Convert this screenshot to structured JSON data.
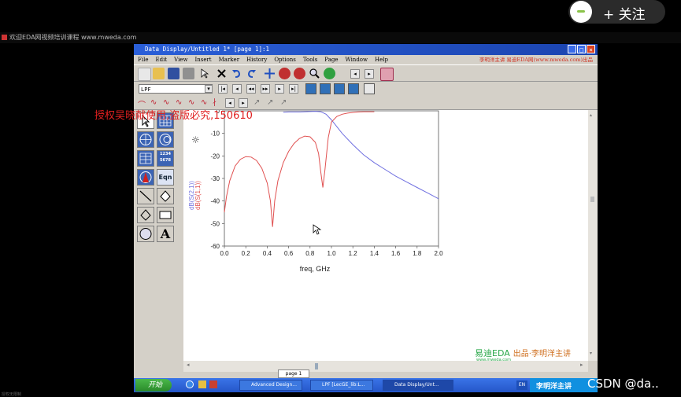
{
  "overlay": {
    "follow_label": "+ 关注"
  },
  "desktop": {
    "title": "欢迎EDA网视频培训课程 www.mweda.com",
    "bottom_text": "授权无限制"
  },
  "window": {
    "title": "Data Display/Untitled 1* [page 1]:1",
    "menu": [
      "File",
      "Edit",
      "View",
      "Insert",
      "Marker",
      "History",
      "Options",
      "Tools",
      "Page",
      "Window",
      "Help"
    ],
    "menu_ad": "李明洋主讲  易迪EDA网(www.mweda.com)出品",
    "page_select": "LPF",
    "page_tab": "page 1",
    "controls": {
      "minimize": "_",
      "maximize": "□",
      "close": "×"
    }
  },
  "watermark": "授权吴晓献使用,盗版必究,150610",
  "logo": {
    "brand": "易迪EDA",
    "sub": "出品·李明洋主讲",
    "url": "www.mweda.com"
  },
  "palette": {
    "eqn_label": "Eqn",
    "table_label": "1234 5678",
    "text_label": "A"
  },
  "taskbar": {
    "start": "开始",
    "tasks": [
      "Advanced Design...",
      "LPF [LecGE_lib:L...",
      "Data Display/Unt..."
    ],
    "tray_text": "李明洋主讲",
    "lang": "EN"
  },
  "footer_credit": "CSDN @da..",
  "chart_data": {
    "type": "line",
    "xlabel": "freq, GHz",
    "ylabel": "",
    "xlim": [
      0.0,
      2.0
    ],
    "ylim": [
      -60,
      0
    ],
    "xticks": [
      "0.0",
      "0.2",
      "0.4",
      "0.6",
      "0.8",
      "1.0",
      "1.2",
      "1.4",
      "1.6",
      "1.8",
      "2.0"
    ],
    "yticks": [
      "0",
      "-10",
      "-20",
      "-30",
      "-40",
      "-50",
      "-60"
    ],
    "grid": false,
    "legend": "left-vertical",
    "series": [
      {
        "name": "dB(S(2,1))",
        "color": "#7070e0",
        "x": [
          0.55,
          0.6,
          0.7,
          0.8,
          0.85,
          0.9,
          0.95,
          1.0,
          1.05,
          1.1,
          1.2,
          1.3,
          1.4,
          1.5,
          1.6,
          1.7,
          1.8,
          1.9,
          2.0
        ],
        "y": [
          -0.6,
          -0.5,
          -0.5,
          -0.3,
          -0.2,
          -0.4,
          -1.5,
          -4.0,
          -7.0,
          -10.0,
          -15.0,
          -19.5,
          -23.0,
          -26.0,
          -29.0,
          -31.5,
          -34.0,
          -36.5,
          -39.0
        ]
      },
      {
        "name": "dB(S(1,1))",
        "color": "#e05050",
        "x": [
          0.0,
          0.02,
          0.05,
          0.1,
          0.15,
          0.2,
          0.25,
          0.3,
          0.35,
          0.4,
          0.43,
          0.45,
          0.47,
          0.5,
          0.55,
          0.6,
          0.65,
          0.7,
          0.75,
          0.8,
          0.85,
          0.88,
          0.9,
          0.92,
          0.94,
          0.97,
          1.0,
          1.05,
          1.1,
          1.15,
          1.2,
          1.25,
          1.3,
          1.35,
          1.4
        ],
        "y": [
          -45.0,
          -38.0,
          -31.0,
          -24.5,
          -21.5,
          -20.3,
          -20.5,
          -22.0,
          -25.5,
          -32.0,
          -40.0,
          -51.5,
          -40.0,
          -31.0,
          -23.0,
          -18.0,
          -14.5,
          -12.3,
          -11.2,
          -11.5,
          -14.0,
          -19.0,
          -27.0,
          -34.0,
          -26.0,
          -12.0,
          -5.0,
          -2.5,
          -1.5,
          -1.0,
          -0.7,
          -0.5,
          -0.4,
          -0.4,
          -0.4
        ]
      }
    ]
  }
}
